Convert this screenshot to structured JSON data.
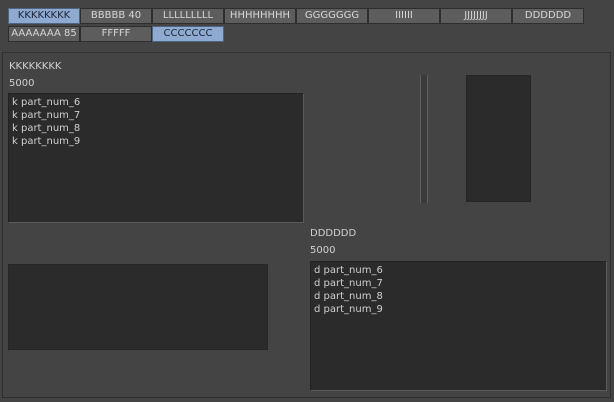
{
  "tabs": [
    {
      "label": "KKKKKKKK",
      "active": true
    },
    {
      "label": "BBBBB 40",
      "active": false
    },
    {
      "label": "LLLLLLLLL",
      "active": false
    },
    {
      "label": "HHHHHHHH",
      "active": false
    },
    {
      "label": "GGGGGGG",
      "active": false
    },
    {
      "label": "IIIIII",
      "active": false
    },
    {
      "label": "JJJJJJJJ",
      "active": false
    },
    {
      "label": "DDDDDD",
      "active": false
    },
    {
      "label": "AAAAAAA 85",
      "active": false
    },
    {
      "label": "FFFFF",
      "active": false
    },
    {
      "label": "CCCCCCC",
      "active": true
    }
  ],
  "left_section": {
    "title": "KKKKKKKK",
    "value": "5000",
    "items": [
      "k part_num_6",
      "k part_num_7",
      "k part_num_8",
      "k part_num_9"
    ]
  },
  "right_section": {
    "title": "DDDDDD",
    "value": "5000",
    "items": [
      "d part_num_6",
      "d part_num_7",
      "d part_num_8",
      "d part_num_9"
    ]
  }
}
